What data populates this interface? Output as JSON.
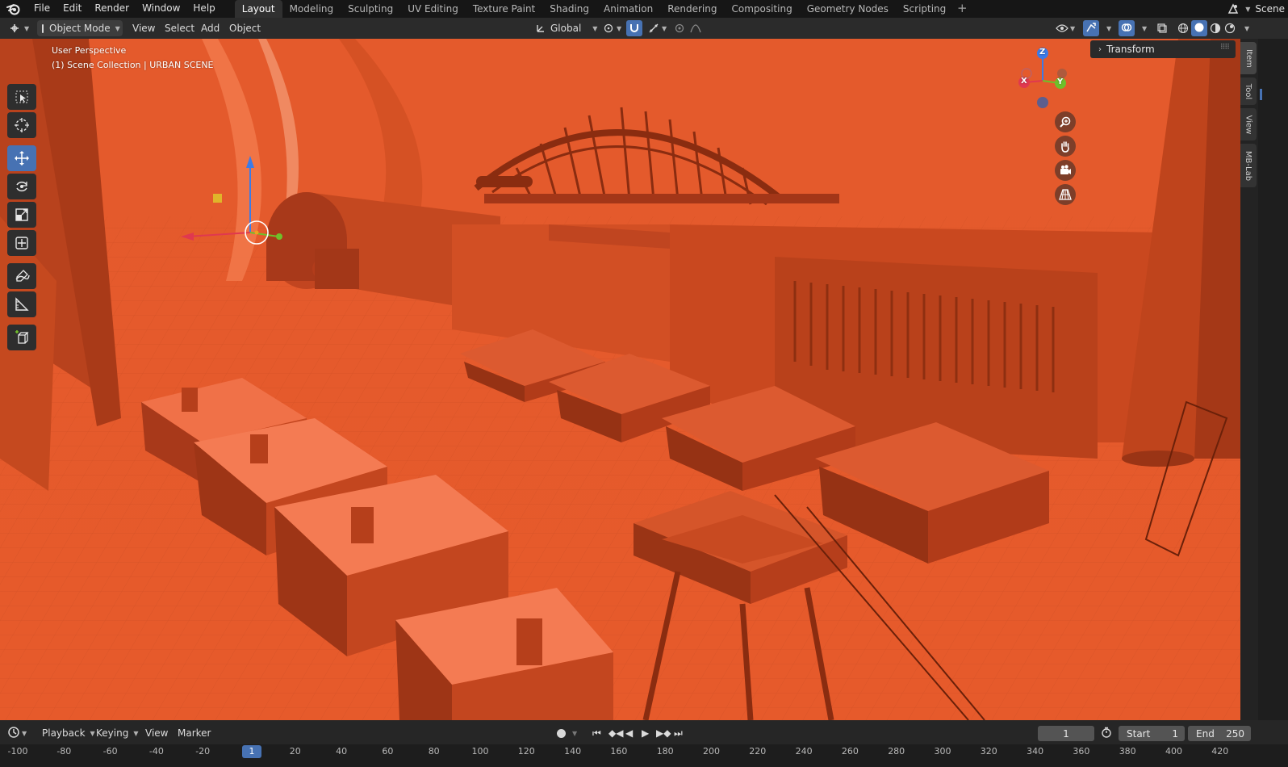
{
  "menubar": {
    "items": [
      "File",
      "Edit",
      "Render",
      "Window",
      "Help"
    ],
    "workspaces": [
      "Layout",
      "Modeling",
      "Sculpting",
      "UV Editing",
      "Texture Paint",
      "Shading",
      "Animation",
      "Rendering",
      "Compositing",
      "Geometry Nodes",
      "Scripting"
    ],
    "active_workspace": "Layout",
    "add_tab": "+",
    "scene": "Scene"
  },
  "header": {
    "mode": "Object Mode",
    "menus": [
      "View",
      "Select",
      "Add",
      "Object"
    ],
    "orientation": "Global"
  },
  "viewport": {
    "perspective": "User Perspective",
    "collection": "(1) Scene Collection | URBAN SCENE",
    "background_color": "#e35528",
    "gizmo": {
      "x": "X",
      "y": "Y",
      "z": "Z"
    }
  },
  "tools": [
    "select-box",
    "cursor",
    "move",
    "rotate",
    "scale",
    "transform",
    "annotate",
    "measure",
    "add-cube"
  ],
  "active_tool": "move",
  "sidebar": {
    "panel_title": "Transform",
    "tabs": [
      "Item",
      "Tool",
      "View",
      "MB-Lab"
    ]
  },
  "timeline": {
    "menus": [
      "Playback",
      "Keying",
      "View",
      "Marker"
    ],
    "current_frame": "1",
    "start_label": "Start",
    "start_value": "1",
    "end_label": "End",
    "end_value": "250",
    "ruler_ticks": [
      "-100",
      "-80",
      "-60",
      "-40",
      "-20",
      "1",
      "20",
      "40",
      "60",
      "80",
      "100",
      "120",
      "140",
      "160",
      "180",
      "200",
      "220",
      "240",
      "260",
      "280",
      "300",
      "320",
      "340",
      "360",
      "380",
      "400",
      "420"
    ],
    "playhead": "1"
  },
  "colors": {
    "accent": "#4772b3",
    "axis_x": "#e0384f",
    "axis_y": "#6fc02a",
    "axis_z": "#3b7be8"
  }
}
